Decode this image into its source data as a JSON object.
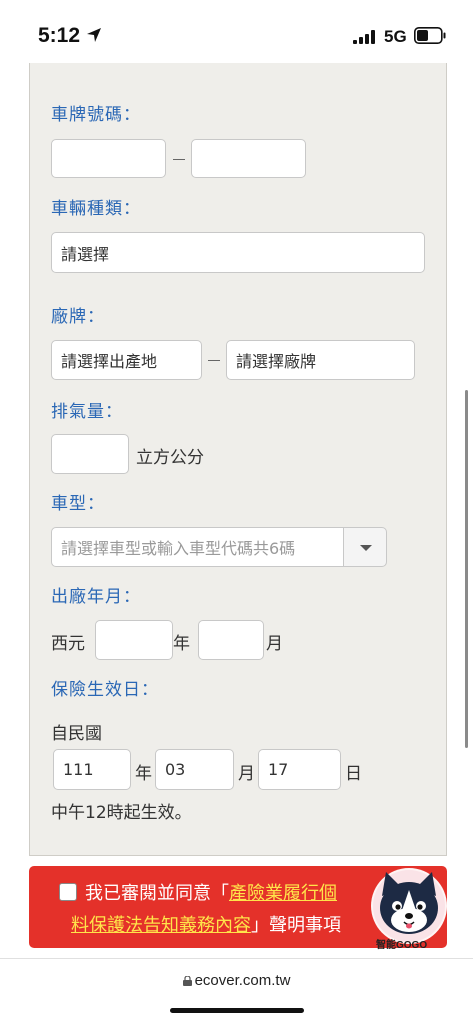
{
  "status_bar": {
    "time": "5:12",
    "network": "5G"
  },
  "form": {
    "plate": {
      "label": "車牌號碼：",
      "part1_value": "",
      "part2_value": ""
    },
    "vehicle_type": {
      "label": "車輛種類：",
      "value": "請選擇"
    },
    "brand": {
      "label": "廠牌：",
      "origin_value": "請選擇出產地",
      "brand_value": "請選擇廠牌"
    },
    "displacement": {
      "label": "排氣量：",
      "value": "",
      "unit": "立方公分"
    },
    "model": {
      "label": "車型：",
      "placeholder": "請選擇車型或輸入車型代碼共6碼"
    },
    "manufacture_date": {
      "label": "出廠年月：",
      "era_prefix": "西元",
      "year_value": "",
      "year_unit": "年",
      "month_value": "",
      "month_unit": "月"
    },
    "effective_date": {
      "label": "保險生效日：",
      "prefix": "自民國",
      "year_value": "111",
      "year_unit": "年",
      "month_value": "03",
      "month_unit": "月",
      "day_value": "17",
      "day_unit": "日",
      "note": "中午12時起生效。"
    }
  },
  "consent": {
    "text_before": "我已審閱並同意「",
    "link_part1": "產險業履行個",
    "link_part2": "料保護法告知義務內容",
    "text_after": "」聲明事項"
  },
  "mascot": {
    "caption": "智能GOGO"
  },
  "browser": {
    "url": "ecover.com.tw"
  },
  "colors": {
    "label_blue": "#2a67b5",
    "banner_red": "#e4312a",
    "link_yellow": "#ffe44a"
  }
}
